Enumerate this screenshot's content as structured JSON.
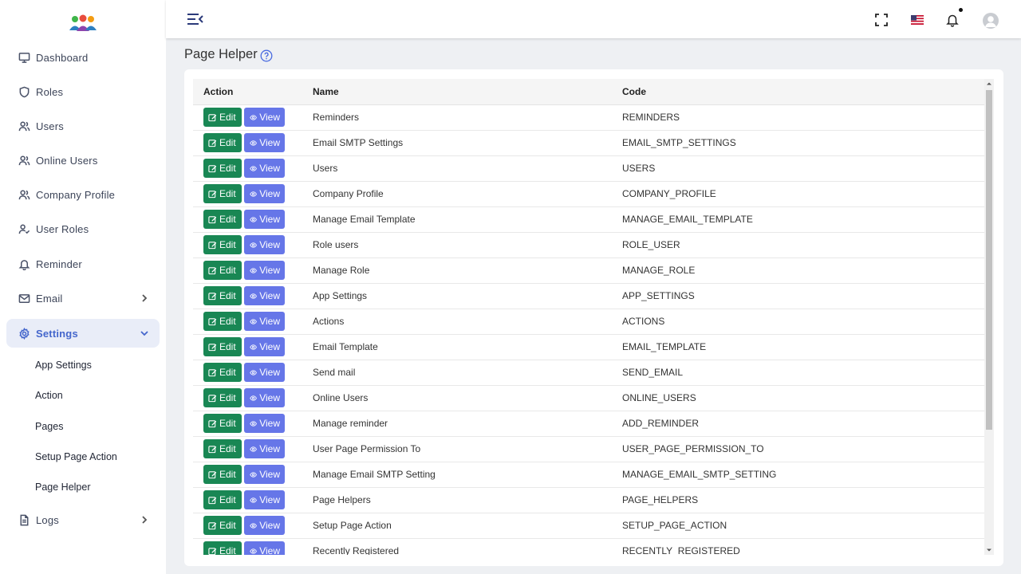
{
  "sidebar": {
    "items": [
      {
        "label": "Dashboard",
        "icon": "monitor-icon"
      },
      {
        "label": "Roles",
        "icon": "shield-icon"
      },
      {
        "label": "Users",
        "icon": "users-icon"
      },
      {
        "label": "Online Users",
        "icon": "users-icon"
      },
      {
        "label": "Company Profile",
        "icon": "users-icon"
      },
      {
        "label": "User Roles",
        "icon": "user-check-icon"
      },
      {
        "label": "Reminder",
        "icon": "bell-icon"
      },
      {
        "label": "Email",
        "icon": "mail-icon"
      },
      {
        "label": "Settings",
        "icon": "gear-icon"
      },
      {
        "label": "Logs",
        "icon": "file-icon"
      }
    ],
    "settings_sub": [
      "App Settings",
      "Action",
      "Pages",
      "Setup Page Action",
      "Page Helper"
    ]
  },
  "page": {
    "title": "Page Helper"
  },
  "table": {
    "headers": {
      "action": "Action",
      "name": "Name",
      "code": "Code"
    },
    "edit_label": "Edit",
    "view_label": "View",
    "rows": [
      {
        "name": "Reminders",
        "code": "REMINDERS"
      },
      {
        "name": "Email SMTP Settings",
        "code": "EMAIL_SMTP_SETTINGS"
      },
      {
        "name": "Users",
        "code": "USERS"
      },
      {
        "name": "Company Profile",
        "code": "COMPANY_PROFILE"
      },
      {
        "name": "Manage Email Template",
        "code": "MANAGE_EMAIL_TEMPLATE"
      },
      {
        "name": "Role users",
        "code": "ROLE_USER"
      },
      {
        "name": "Manage Role",
        "code": "MANAGE_ROLE"
      },
      {
        "name": "App Settings",
        "code": "APP_SETTINGS"
      },
      {
        "name": "Actions",
        "code": "ACTIONS"
      },
      {
        "name": "Email Template",
        "code": "EMAIL_TEMPLATE"
      },
      {
        "name": "Send mail",
        "code": "SEND_EMAIL"
      },
      {
        "name": "Online Users",
        "code": "ONLINE_USERS"
      },
      {
        "name": "Manage reminder",
        "code": "ADD_REMINDER"
      },
      {
        "name": "User Page Permission To",
        "code": "USER_PAGE_PERMISSION_TO"
      },
      {
        "name": "Manage Email SMTP Setting",
        "code": "MANAGE_EMAIL_SMTP_SETTING"
      },
      {
        "name": "Page Helpers",
        "code": "PAGE_HELPERS"
      },
      {
        "name": "Setup Page Action",
        "code": "SETUP_PAGE_ACTION"
      },
      {
        "name": "Recently Registered",
        "code": "RECENTLY_REGISTERED"
      }
    ]
  },
  "colors": {
    "edit_button": "#198754",
    "view_button": "#6676e8",
    "active_nav": "#4466cc"
  }
}
